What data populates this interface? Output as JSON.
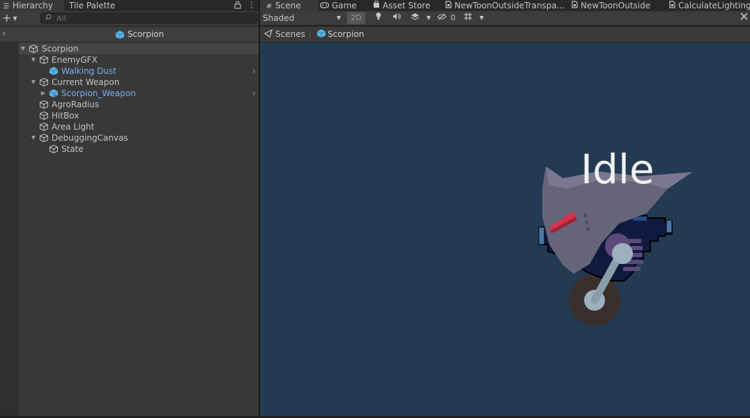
{
  "hierarchy": {
    "tabs": [
      {
        "label": "Hierarchy",
        "icon": "list-icon",
        "active": true
      },
      {
        "label": "Tile Palette",
        "active": false
      }
    ],
    "lock_icon": "lock-icon",
    "menu_icon": "kebab-menu-icon",
    "add_button": {
      "label": "+",
      "icon": "plus-icon"
    },
    "search": {
      "placeholder": "All",
      "value": ""
    },
    "scene_header": {
      "back_icon": "chevron-left-icon",
      "title": "Scorpion"
    },
    "tree": [
      {
        "label": "Scorpion",
        "depth": 0,
        "expanded": true,
        "selected": true,
        "prefab": false
      },
      {
        "label": "EnemyGFX",
        "depth": 1,
        "expanded": true,
        "prefab": false
      },
      {
        "label": "Walking Dust",
        "depth": 2,
        "prefab": true,
        "has_arrow": true
      },
      {
        "label": "Current Weapon",
        "depth": 1,
        "expanded": true,
        "prefab": false
      },
      {
        "label": "Scorpion_Weapon",
        "depth": 2,
        "collapsed": true,
        "prefab": true,
        "has_arrow": true
      },
      {
        "label": "AgroRadius",
        "depth": 1,
        "prefab": false
      },
      {
        "label": "HitBox",
        "depth": 1,
        "prefab": false
      },
      {
        "label": "Area Light",
        "depth": 1,
        "prefab": false
      },
      {
        "label": "DebuggingCanvas",
        "depth": 1,
        "expanded": true,
        "prefab": false
      },
      {
        "label": "State",
        "depth": 2,
        "prefab": false
      }
    ]
  },
  "editor_tabs": [
    {
      "label": "Scene",
      "icon": "grid-icon",
      "active": true
    },
    {
      "label": "Game",
      "icon": "gamepad-icon"
    },
    {
      "label": "Asset Store",
      "icon": "bag-icon"
    },
    {
      "label": "NewToonOutsideTranspa...",
      "icon": "shader-file-icon"
    },
    {
      "label": "NewToonOutside",
      "icon": "shader-file-icon"
    },
    {
      "label": "CalculateLighting",
      "icon": "shader-file-icon"
    }
  ],
  "scene_toolbar": {
    "shading_mode": "Shaded",
    "mode_2d": "2D",
    "hidden_count": "0",
    "tools_icon": "tools-icon"
  },
  "breadcrumb": {
    "root": "Scenes",
    "current": "Scorpion"
  },
  "viewport": {
    "state_text": "Idle",
    "background_color": "#223a52"
  },
  "colors": {
    "prefab_blue": "#7caef0",
    "panel": "#383838",
    "selection": "#454545"
  }
}
